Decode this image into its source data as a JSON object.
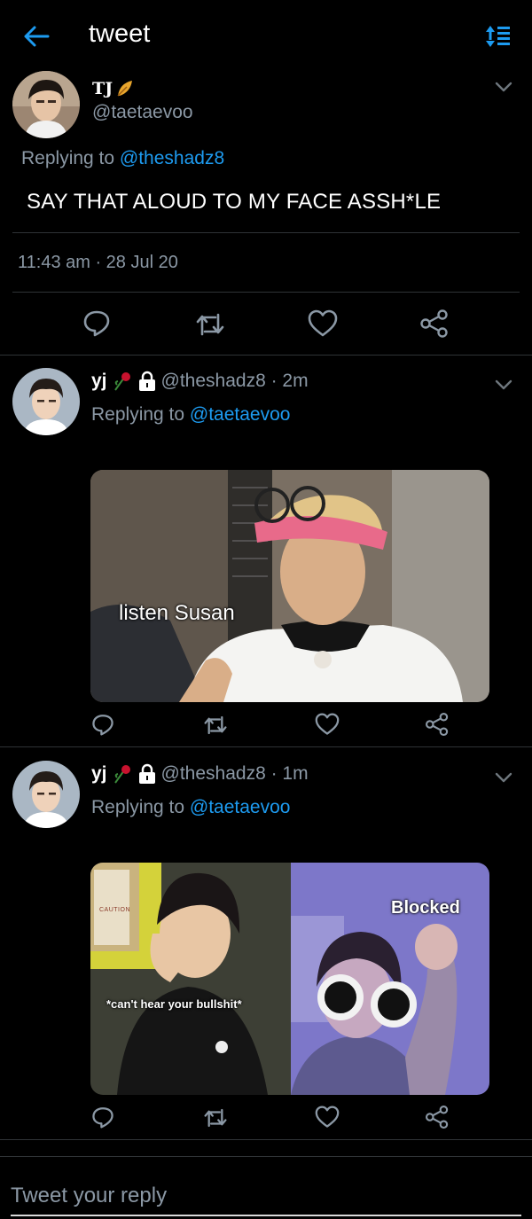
{
  "header": {
    "title": "tweet",
    "back_icon": "arrow-left-icon",
    "sort_icon": "sort-icon",
    "accent": "#1d9bf0"
  },
  "main_tweet": {
    "display_name": "TJ",
    "name_emoji": "leaf-emoji",
    "handle": "@taetaevoo",
    "replying_prefix": "Replying to",
    "replying_handle": "@theshadz8",
    "text": "SAY THAT ALOUD TO MY FACE ASSH*LE",
    "timestamp": "11:43 am · 28 Jul 20"
  },
  "replies": [
    {
      "display_name": "yj",
      "handle_meta": "@theshadz8 · 2m",
      "replying_prefix": "Replying to",
      "replying_handle": "@taetaevoo",
      "media_caption": "listen Susan"
    },
    {
      "display_name": "yj",
      "handle_meta": "@theshadz8 · 1m",
      "replying_prefix": "Replying to",
      "replying_handle": "@taetaevoo",
      "media_caption_left": "*can't hear your bullshit*",
      "media_caption_right": "Blocked",
      "media_sign": "CAUTION"
    }
  ],
  "composer": {
    "placeholder": "Tweet your reply"
  },
  "colors": {
    "background": "#000000",
    "divider": "#2f3336",
    "muted": "#8b98a5",
    "link": "#1d9bf0"
  }
}
